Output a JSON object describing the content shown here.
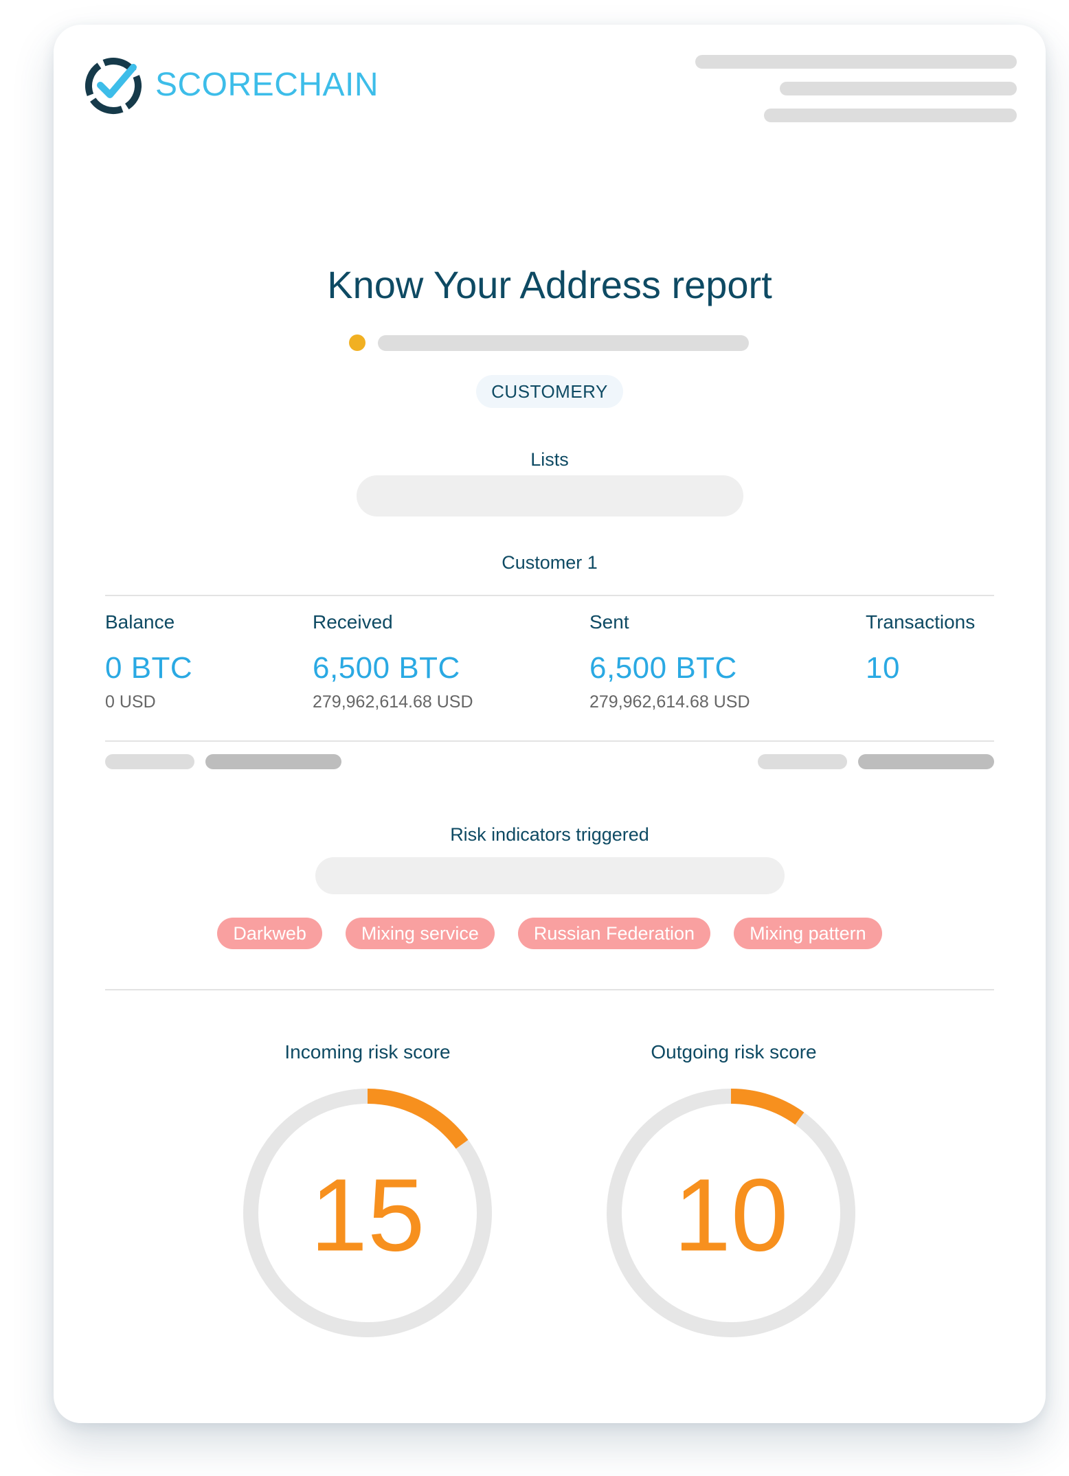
{
  "brand": {
    "name": "SCORECHAIN",
    "accent": "#3dbde9",
    "dark": "#163a4a",
    "logo_icon": "check-circle-icon"
  },
  "report": {
    "title": "Know Your Address report",
    "status_dot_color": "#f1b022",
    "customer_tag": "CUSTOMERY"
  },
  "lists": {
    "label": "Lists"
  },
  "customer": {
    "label": "Customer 1"
  },
  "stats": {
    "balance": {
      "label": "Balance",
      "value": "0 BTC",
      "usd": "0 USD"
    },
    "received": {
      "label": "Received",
      "value": "6,500 BTC",
      "usd": "279,962,614.68 USD"
    },
    "sent": {
      "label": "Sent",
      "value": "6,500 BTC",
      "usd": "279,962,614.68 USD"
    },
    "transactions": {
      "label": "Transactions",
      "value": "10"
    }
  },
  "risk": {
    "label": "Risk indicators triggered",
    "tags": [
      "Darkweb",
      "Mixing service",
      "Russian Federation",
      "Mixing pattern"
    ],
    "tag_color": "#f9a0a0"
  },
  "scores": {
    "incoming": {
      "label": "Incoming risk score",
      "value": "15",
      "fraction": 0.15
    },
    "outgoing": {
      "label": "Outgoing risk score",
      "value": "10",
      "fraction": 0.1
    },
    "color": "#f7901e",
    "track_color": "#e6e6e6"
  }
}
